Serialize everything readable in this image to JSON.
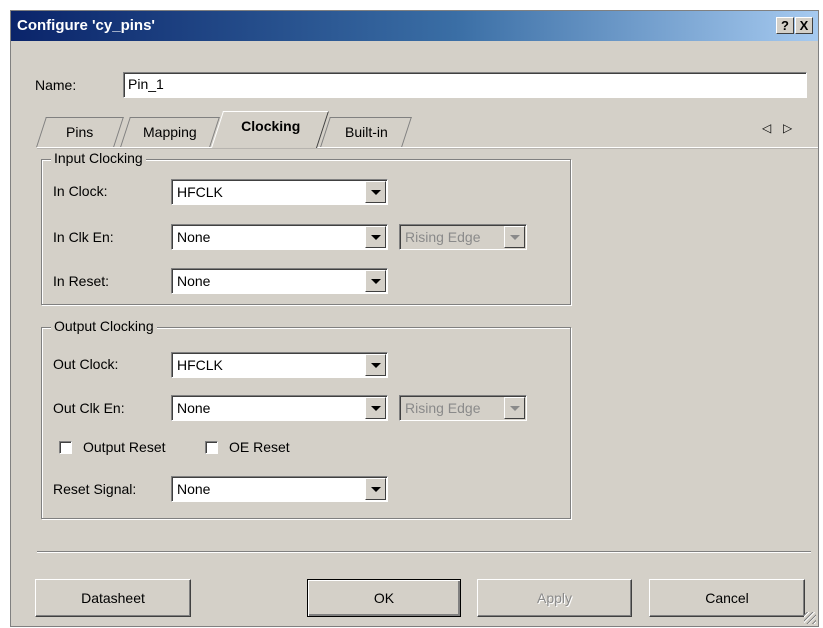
{
  "window": {
    "title": "Configure 'cy_pins'",
    "help_label": "?",
    "close_label": "X"
  },
  "name_field": {
    "label": "Name:",
    "value": "Pin_1"
  },
  "tabs": [
    {
      "label": "Pins"
    },
    {
      "label": "Mapping"
    },
    {
      "label": "Clocking"
    },
    {
      "label": "Built-in"
    }
  ],
  "active_tab": "Clocking",
  "tab_scroll": {
    "left": "◁",
    "right": "▷"
  },
  "input_clocking": {
    "title": "Input Clocking",
    "in_clock": {
      "label": "In Clock:",
      "value": "HFCLK"
    },
    "in_clk_en": {
      "label": "In Clk En:",
      "value": "None",
      "edge": "Rising Edge"
    },
    "in_reset": {
      "label": "In Reset:",
      "value": "None"
    }
  },
  "output_clocking": {
    "title": "Output Clocking",
    "out_clock": {
      "label": "Out Clock:",
      "value": "HFCLK"
    },
    "out_clk_en": {
      "label": "Out Clk En:",
      "value": "None",
      "edge": "Rising Edge"
    },
    "output_reset": {
      "label": "Output Reset",
      "checked": false
    },
    "oe_reset": {
      "label": "OE Reset",
      "checked": false
    },
    "reset_signal": {
      "label": "Reset Signal:",
      "value": "None"
    }
  },
  "buttons": {
    "datasheet": "Datasheet",
    "ok": "OK",
    "apply": "Apply",
    "cancel": "Cancel"
  },
  "colors": {
    "titlebar_start": "#0a246a",
    "titlebar_end": "#a6caf0",
    "face": "#d4d0c8",
    "disabled_text": "#8a8a8a"
  }
}
